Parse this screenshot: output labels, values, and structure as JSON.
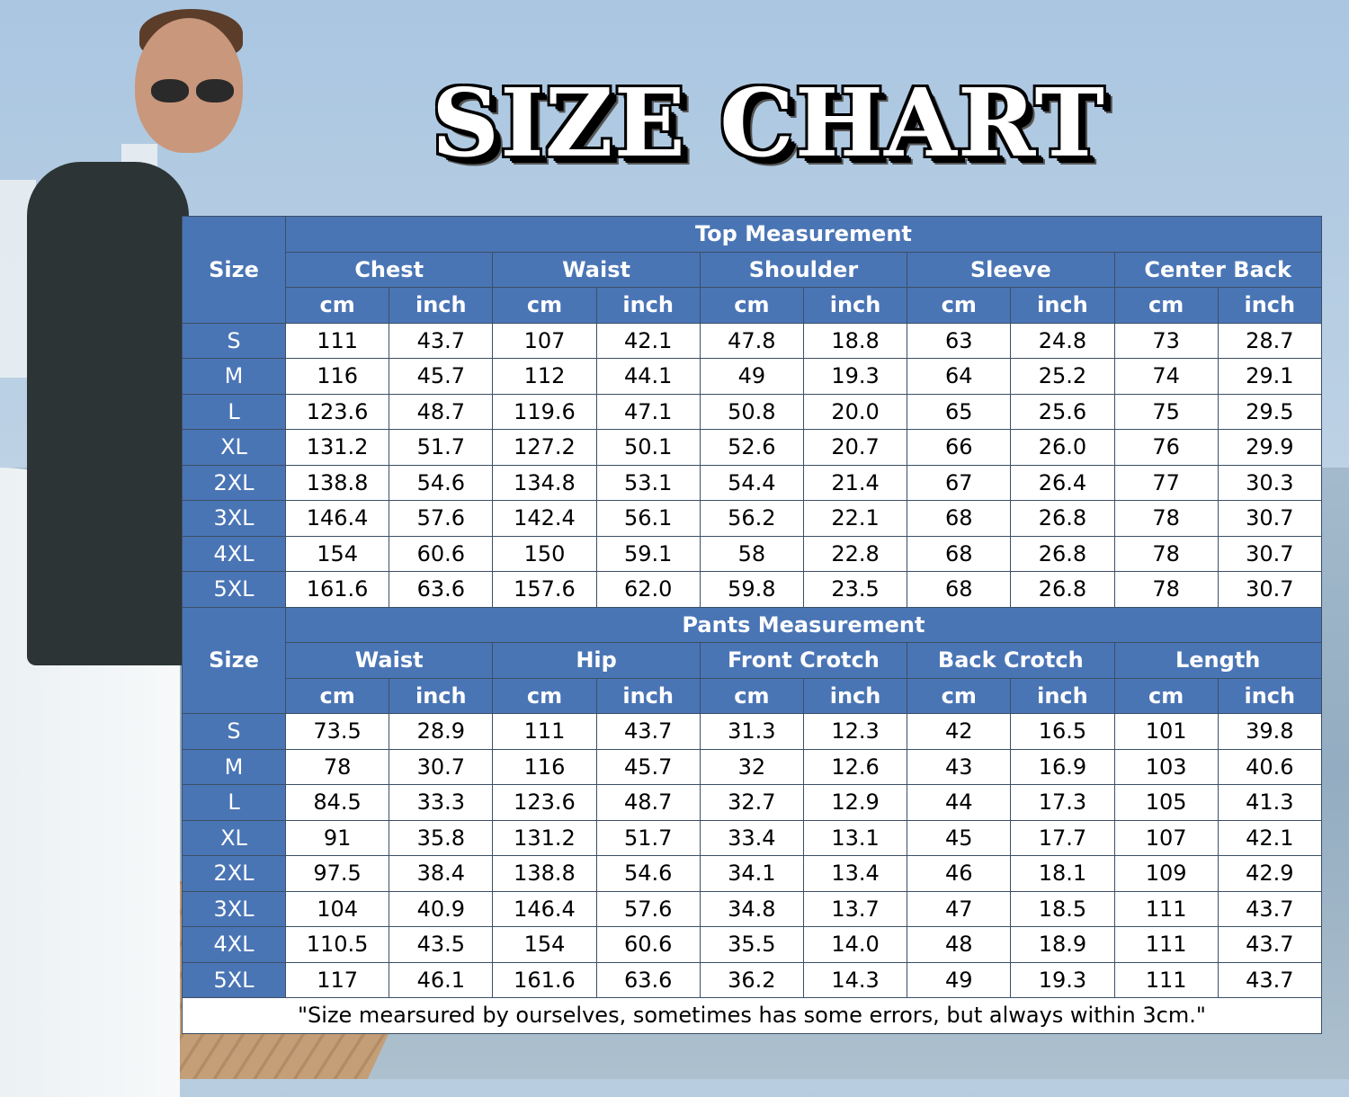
{
  "title": "SIZE CHART",
  "colors": {
    "header_blue": "#4a75b5",
    "cell_white": "#ffffff",
    "title_shadow": "#000000"
  },
  "top": {
    "section_title": "Top Measurement",
    "size_label": "Size",
    "groups": [
      "Chest",
      "Waist",
      "Shoulder",
      "Sleeve",
      "Center Back"
    ],
    "units": [
      "cm",
      "inch"
    ],
    "rows": [
      {
        "size": "S",
        "values": [
          "111",
          "43.7",
          "107",
          "42.1",
          "47.8",
          "18.8",
          "63",
          "24.8",
          "73",
          "28.7"
        ]
      },
      {
        "size": "M",
        "values": [
          "116",
          "45.7",
          "112",
          "44.1",
          "49",
          "19.3",
          "64",
          "25.2",
          "74",
          "29.1"
        ]
      },
      {
        "size": "L",
        "values": [
          "123.6",
          "48.7",
          "119.6",
          "47.1",
          "50.8",
          "20.0",
          "65",
          "25.6",
          "75",
          "29.5"
        ]
      },
      {
        "size": "XL",
        "values": [
          "131.2",
          "51.7",
          "127.2",
          "50.1",
          "52.6",
          "20.7",
          "66",
          "26.0",
          "76",
          "29.9"
        ]
      },
      {
        "size": "2XL",
        "values": [
          "138.8",
          "54.6",
          "134.8",
          "53.1",
          "54.4",
          "21.4",
          "67",
          "26.4",
          "77",
          "30.3"
        ]
      },
      {
        "size": "3XL",
        "values": [
          "146.4",
          "57.6",
          "142.4",
          "56.1",
          "56.2",
          "22.1",
          "68",
          "26.8",
          "78",
          "30.7"
        ]
      },
      {
        "size": "4XL",
        "values": [
          "154",
          "60.6",
          "150",
          "59.1",
          "58",
          "22.8",
          "68",
          "26.8",
          "78",
          "30.7"
        ]
      },
      {
        "size": "5XL",
        "values": [
          "161.6",
          "63.6",
          "157.6",
          "62.0",
          "59.8",
          "23.5",
          "68",
          "26.8",
          "78",
          "30.7"
        ]
      }
    ]
  },
  "pants": {
    "section_title": "Pants Measurement",
    "size_label": "Size",
    "groups": [
      "Waist",
      "Hip",
      "Front Crotch",
      "Back Crotch",
      "Length"
    ],
    "units": [
      "cm",
      "inch"
    ],
    "rows": [
      {
        "size": "S",
        "values": [
          "73.5",
          "28.9",
          "111",
          "43.7",
          "31.3",
          "12.3",
          "42",
          "16.5",
          "101",
          "39.8"
        ]
      },
      {
        "size": "M",
        "values": [
          "78",
          "30.7",
          "116",
          "45.7",
          "32",
          "12.6",
          "43",
          "16.9",
          "103",
          "40.6"
        ]
      },
      {
        "size": "L",
        "values": [
          "84.5",
          "33.3",
          "123.6",
          "48.7",
          "32.7",
          "12.9",
          "44",
          "17.3",
          "105",
          "41.3"
        ]
      },
      {
        "size": "XL",
        "values": [
          "91",
          "35.8",
          "131.2",
          "51.7",
          "33.4",
          "13.1",
          "45",
          "17.7",
          "107",
          "42.1"
        ]
      },
      {
        "size": "2XL",
        "values": [
          "97.5",
          "38.4",
          "138.8",
          "54.6",
          "34.1",
          "13.4",
          "46",
          "18.1",
          "109",
          "42.9"
        ]
      },
      {
        "size": "3XL",
        "values": [
          "104",
          "40.9",
          "146.4",
          "57.6",
          "34.8",
          "13.7",
          "47",
          "18.5",
          "111",
          "43.7"
        ]
      },
      {
        "size": "4XL",
        "values": [
          "110.5",
          "43.5",
          "154",
          "60.6",
          "35.5",
          "14.0",
          "48",
          "18.9",
          "111",
          "43.7"
        ]
      },
      {
        "size": "5XL",
        "values": [
          "117",
          "46.1",
          "161.6",
          "63.6",
          "36.2",
          "14.3",
          "49",
          "19.3",
          "111",
          "43.7"
        ]
      }
    ]
  },
  "note": "\"Size mearsured by ourselves, sometimes has some errors, but always within 3cm.\""
}
